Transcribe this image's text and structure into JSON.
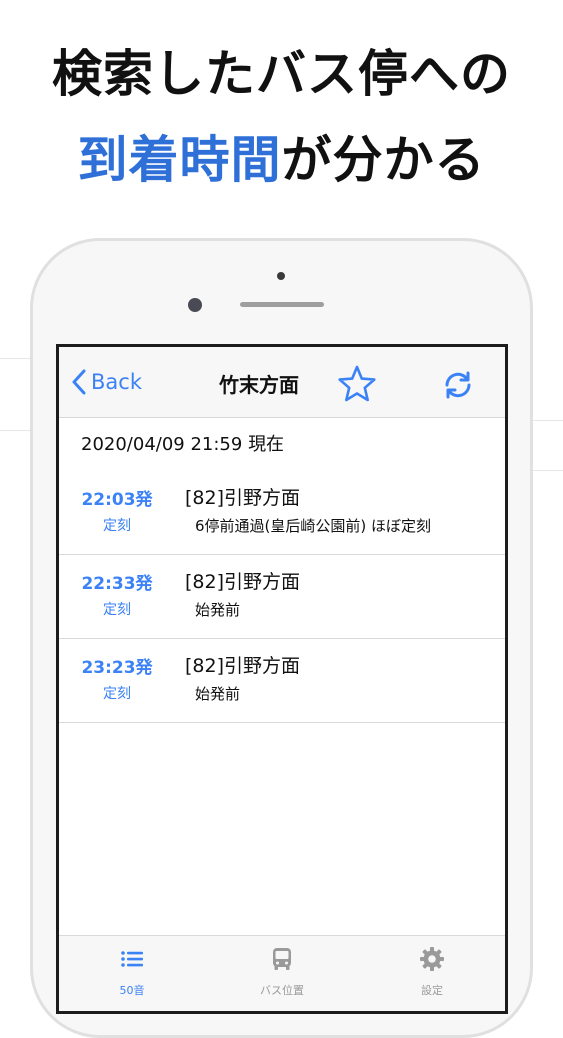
{
  "headline": {
    "line1": "検索したバス停への",
    "line2_highlight": "到着時間",
    "line2_rest": "が分かる"
  },
  "navbar": {
    "back_label": "Back",
    "title": "竹末方面"
  },
  "timestamp": "2020/04/09 21:59 現在",
  "departures": [
    {
      "time": "22:03発",
      "status": "定刻",
      "route": "[82]引野方面",
      "detail": "6停前通過(皇后崎公園前) ほぼ定刻"
    },
    {
      "time": "22:33発",
      "status": "定刻",
      "route": "[82]引野方面",
      "detail": "始発前"
    },
    {
      "time": "23:23発",
      "status": "定刻",
      "route": "[82]引野方面",
      "detail": "始発前"
    }
  ],
  "tabs": [
    {
      "label": "50音",
      "icon": "list-icon",
      "active": true
    },
    {
      "label": "バス位置",
      "icon": "bus-icon",
      "active": false
    },
    {
      "label": "設定",
      "icon": "gear-icon",
      "active": false
    }
  ],
  "colors": {
    "accent": "#3b82f6",
    "headline_highlight": "#2e6fd8",
    "inactive_tab": "#9a9a9a"
  }
}
